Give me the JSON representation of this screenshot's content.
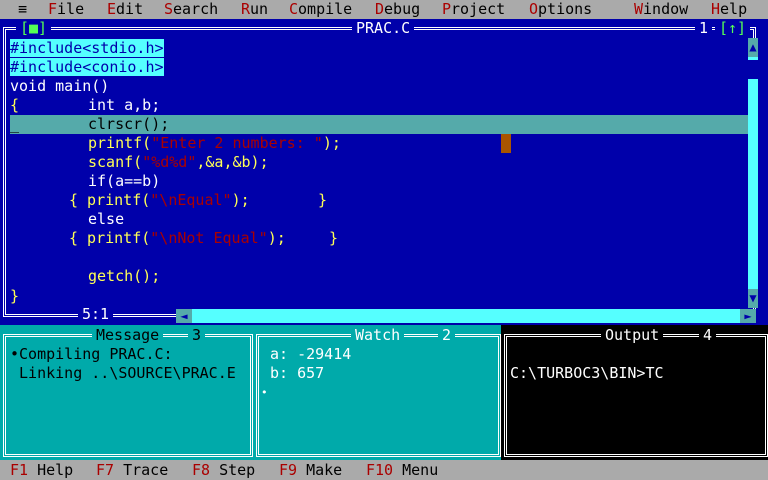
{
  "menubar": {
    "system_glyph": "≡",
    "items": [
      {
        "hot": "F",
        "rest": "ile"
      },
      {
        "hot": "E",
        "rest": "dit"
      },
      {
        "hot": "S",
        "rest": "earch"
      },
      {
        "hot": "R",
        "rest": "un"
      },
      {
        "hot": "C",
        "rest": "ompile"
      },
      {
        "hot": "D",
        "rest": "ebug"
      },
      {
        "hot": "P",
        "rest": "roject"
      },
      {
        "hot": "O",
        "rest": "ptions"
      },
      {
        "hot": "W",
        "rest": "indow"
      },
      {
        "hot": "H",
        "rest": "elp"
      }
    ]
  },
  "editor": {
    "close_glyph": "[■]",
    "title": "PRAC.C",
    "window_number": "1",
    "zoom_glyph": "[↑]",
    "cursor_position": "5:1",
    "code": {
      "include1": "#include<stdio.h>",
      "include2": "#include<conio.h>",
      "main": "void main()",
      "brace_open": "{",
      "decl": "int a,b;",
      "cursor_char": "_",
      "clrscr": "clrscr();",
      "printf1_a": "printf(",
      "printf1_str": "\"Enter 2 numbers: \"",
      "printf1_b": ");",
      "scanf_a": "scanf(",
      "scanf_str": "\"%d%d\"",
      "scanf_b": ",&a,&b);",
      "if_line": "if(a==b)",
      "printf2_a": "{ printf(",
      "printf2_str": "\"\\nEqual\"",
      "printf2_b": ");",
      "printf2_close": "}",
      "else_line": "else",
      "printf3_a": "{ printf(",
      "printf3_str": "\"\\nNot Equal\"",
      "printf3_b": ");",
      "printf3_close": "}",
      "getch": "getch();",
      "brace_close": "}"
    }
  },
  "panes": {
    "message": {
      "title": "Message",
      "number": "3",
      "lines": [
        "•Compiling PRAC.C:",
        " Linking ..\\SOURCE\\PRAC.E"
      ]
    },
    "watch": {
      "title": "Watch",
      "number": "2",
      "lines": [
        "a: -29414",
        "b: 657",
        "•"
      ]
    },
    "output": {
      "title": "Output",
      "number": "4",
      "lines": [
        "C:\\TURBOC3\\BIN>TC"
      ]
    }
  },
  "statusbar": {
    "keys": [
      {
        "key": "F1",
        "label": "Help"
      },
      {
        "key": "F7",
        "label": "Trace"
      },
      {
        "key": "F8",
        "label": "Step"
      },
      {
        "key": "F9",
        "label": "Make"
      },
      {
        "key": "F10",
        "label": "Menu"
      }
    ]
  },
  "colors": {
    "editor_bg": "#0000aa",
    "code_text": "#ffff55",
    "string_text": "#aa0000",
    "highlight_bar": "#55aaaa",
    "menu_bg": "#aaaaaa",
    "hotkey": "#aa0000",
    "pane_bg": "#00aaaa",
    "output_bg": "#000000"
  }
}
